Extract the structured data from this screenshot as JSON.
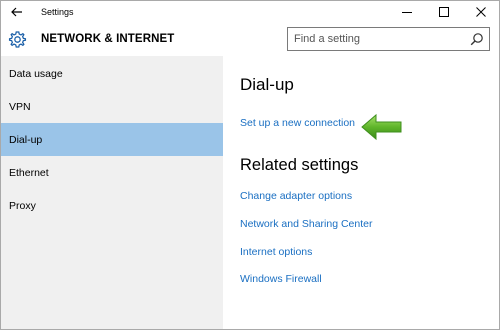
{
  "window": {
    "title": "Settings"
  },
  "header": {
    "section_title": "NETWORK & INTERNET",
    "search_placeholder": "Find a setting"
  },
  "sidebar": {
    "items": [
      {
        "label": "Data usage"
      },
      {
        "label": "VPN"
      },
      {
        "label": "Dial-up",
        "selected": true
      },
      {
        "label": "Ethernet"
      },
      {
        "label": "Proxy"
      }
    ]
  },
  "main": {
    "heading": "Dial-up",
    "setup_link": "Set up a new connection",
    "related_heading": "Related settings",
    "related_links": [
      {
        "label": "Change adapter options"
      },
      {
        "label": "Network and Sharing Center"
      },
      {
        "label": "Internet options"
      },
      {
        "label": "Windows Firewall"
      }
    ]
  },
  "colors": {
    "accent_link": "#1a6fc2",
    "selected_nav": "#9ac4e8",
    "sidebar_bg": "#f0f0f0",
    "arrow_green": "#5fb52a"
  },
  "icons": [
    "back-arrow-icon",
    "minimize-icon",
    "maximize-icon",
    "close-icon",
    "gear-icon",
    "search-icon",
    "green-arrow-icon"
  ]
}
